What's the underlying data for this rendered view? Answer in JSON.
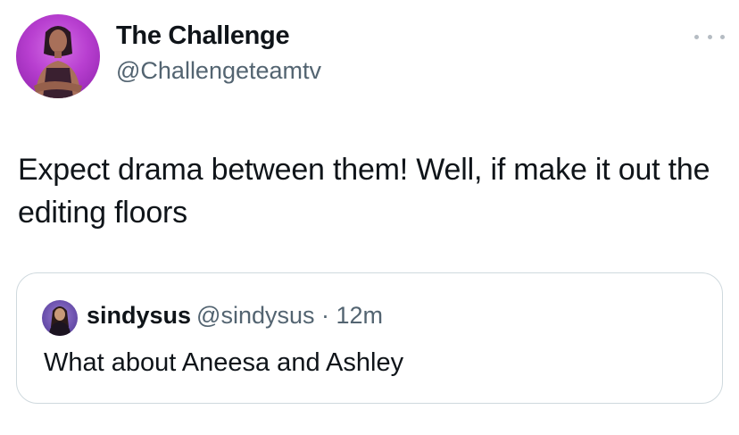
{
  "tweet": {
    "author_name": "The Challenge",
    "author_handle": "@Challengeteamtv",
    "avatar_icon": "profile-photo-icon",
    "more_icon": "more-options-icon",
    "text": "Expect drama between them! Well, if make it out the editing floors"
  },
  "quoted_tweet": {
    "author_name": "sindysus",
    "author_handle": "@sindysus",
    "separator": " · ",
    "time": "12m",
    "text": "What about Aneesa and Ashley",
    "avatar_icon": "profile-photo-icon"
  },
  "colors": {
    "primary_text": "#0f1419",
    "secondary_text": "#536471",
    "border": "#cfd9de",
    "avatar_bg": "#b83fd0"
  }
}
